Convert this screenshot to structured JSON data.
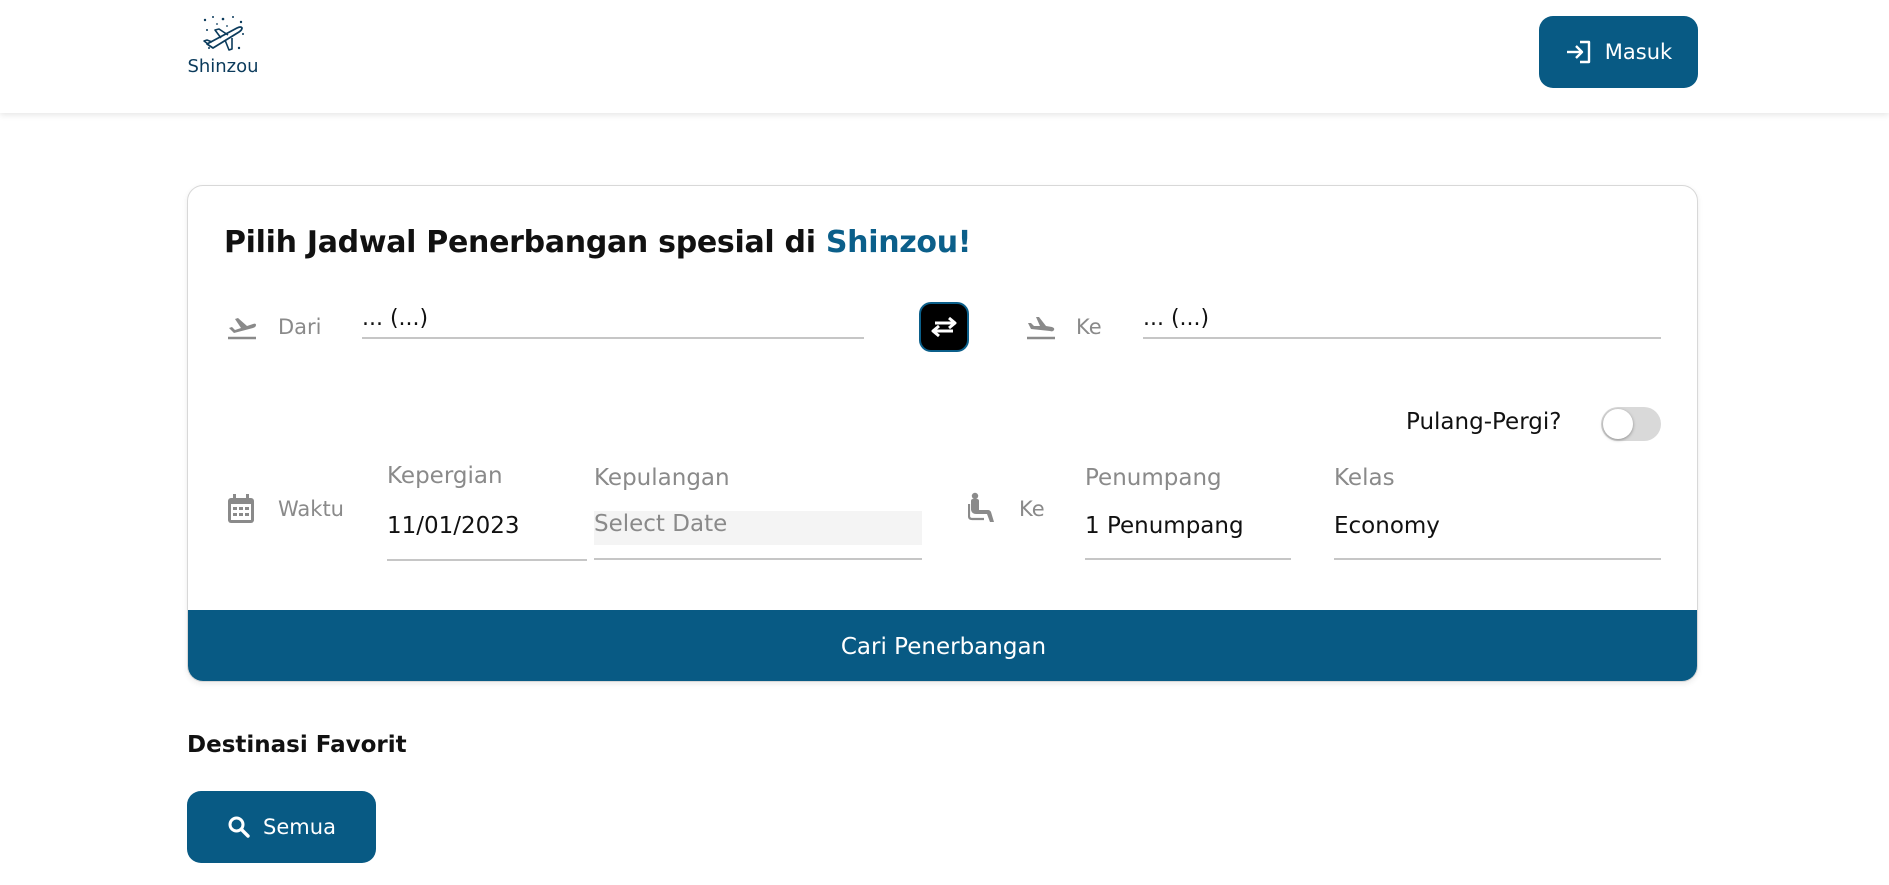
{
  "header": {
    "logo_text": "Shinzou",
    "login_label": "Masuk",
    "login_icon": "login-icon"
  },
  "search": {
    "title_prefix": "Pilih Jadwal Penerbangan spesial di",
    "title_brand": "Shinzou!",
    "from_label": "Dari",
    "from_value": "... (...)",
    "to_label": "Ke",
    "to_value": "... (...)",
    "roundtrip_label": "Pulang-Pergi?",
    "roundtrip_on": false,
    "time_label": "Waktu",
    "depart_caption": "Kepergian",
    "depart_value": "11/01/2023",
    "return_caption": "Kepulangan",
    "return_placeholder": "Select Date",
    "seat_label": "Ke",
    "passenger_caption": "Penumpang",
    "passenger_value": "1 Penumpang",
    "class_caption": "Kelas",
    "class_value": "Economy",
    "submit_label": "Cari Penerbangan"
  },
  "favorites": {
    "title": "Destinasi Favorit",
    "all_label": "Semua"
  },
  "colors": {
    "primary": "#085a84",
    "brand_text": "#0b5f8a"
  }
}
